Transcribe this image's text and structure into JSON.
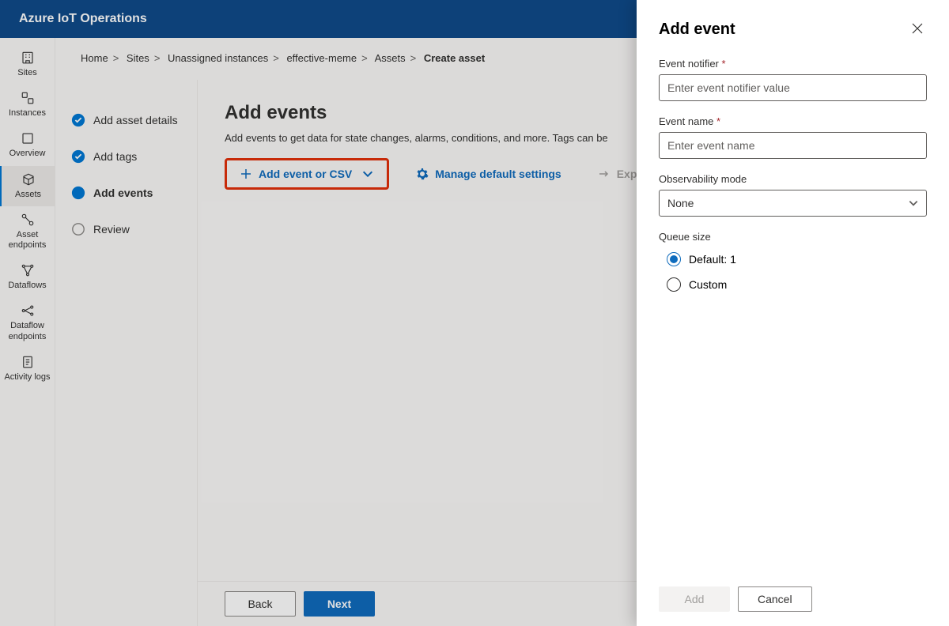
{
  "banner": {
    "title": "Azure IoT Operations"
  },
  "nav": {
    "items": [
      {
        "key": "sites",
        "label": "Sites"
      },
      {
        "key": "instances",
        "label": "Instances"
      },
      {
        "key": "overview",
        "label": "Overview"
      },
      {
        "key": "assets",
        "label": "Assets"
      },
      {
        "key": "asset-endpoints",
        "label": "Asset endpoints"
      },
      {
        "key": "dataflows",
        "label": "Dataflows"
      },
      {
        "key": "dataflow-endpoints",
        "label": "Dataflow endpoints"
      },
      {
        "key": "activity-logs",
        "label": "Activity logs"
      }
    ],
    "active": "assets"
  },
  "breadcrumb": {
    "items": [
      "Home",
      "Sites",
      "Unassigned instances",
      "effective-meme",
      "Assets"
    ],
    "current": "Create asset"
  },
  "wizard": {
    "steps": [
      {
        "label": "Add asset details",
        "state": "done"
      },
      {
        "label": "Add tags",
        "state": "done"
      },
      {
        "label": "Add events",
        "state": "active"
      },
      {
        "label": "Review",
        "state": "pending"
      }
    ]
  },
  "pane": {
    "title": "Add events",
    "desc": "Add events to get data for state changes, alarms, conditions, and more. Tags can be",
    "toolbar": {
      "add_label": "Add event or CSV",
      "manage_label": "Manage default settings",
      "export_label": "Export all"
    },
    "back_label": "Back",
    "next_label": "Next"
  },
  "flyout": {
    "title": "Add event",
    "notifier_label": "Event notifier",
    "notifier_placeholder": "Enter event notifier value",
    "name_label": "Event name",
    "name_placeholder": "Enter event name",
    "obs_label": "Observability mode",
    "obs_value": "None",
    "queue_label": "Queue size",
    "queue_options": [
      {
        "label": "Default: 1",
        "checked": true
      },
      {
        "label": "Custom",
        "checked": false
      }
    ],
    "add_label": "Add",
    "cancel_label": "Cancel"
  }
}
